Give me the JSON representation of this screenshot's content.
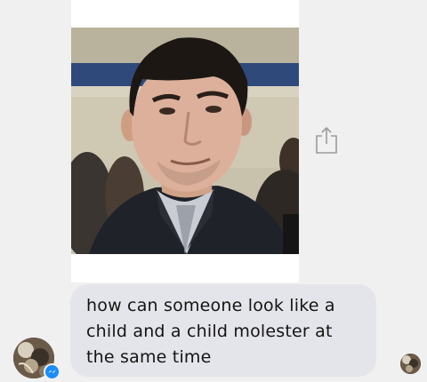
{
  "message": {
    "line1": "how can someone look like a",
    "line2": "child and a child molester at",
    "line3": "the same time"
  },
  "icons": {
    "share": "share-icon",
    "messenger_badge": "messenger-icon"
  },
  "colors": {
    "background": "#f1f0f0",
    "bubble": "#e4e5ea",
    "badge": "#1a8cff",
    "text": "#141414"
  }
}
